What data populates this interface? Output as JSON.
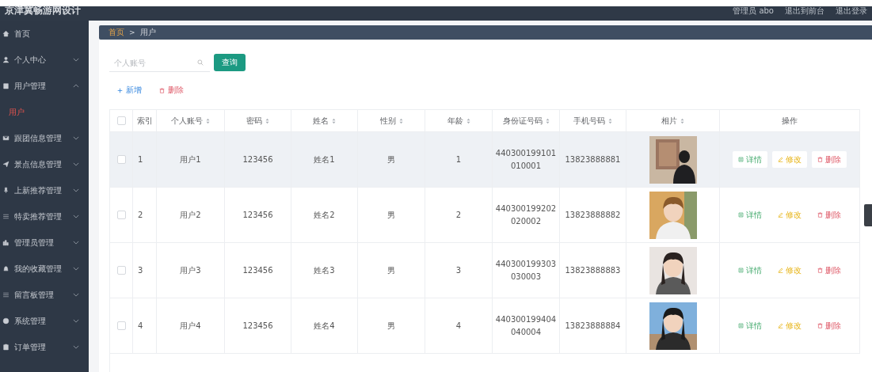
{
  "header": {
    "title": "京津冀畅游网设计",
    "user": "管理员 abo",
    "links": [
      "退出到前台",
      "退出登录"
    ]
  },
  "sidebar": {
    "items": [
      {
        "label": "首页",
        "expandable": false
      },
      {
        "label": "个人中心",
        "expandable": true,
        "expanded": false
      },
      {
        "label": "用户管理",
        "expandable": true,
        "expanded": true,
        "children": [
          {
            "label": "用户",
            "selected": true
          }
        ]
      },
      {
        "label": "跟团信息管理",
        "expandable": true,
        "expanded": false
      },
      {
        "label": "景点信息管理",
        "expandable": true,
        "expanded": false
      },
      {
        "label": "上新推荐管理",
        "expandable": true,
        "expanded": false
      },
      {
        "label": "特卖推荐管理",
        "expandable": true,
        "expanded": false
      },
      {
        "label": "管理员管理",
        "expandable": true,
        "expanded": false
      },
      {
        "label": "我的收藏管理",
        "expandable": true,
        "expanded": false
      },
      {
        "label": "留言板管理",
        "expandable": true,
        "expanded": false
      },
      {
        "label": "系统管理",
        "expandable": true,
        "expanded": false
      },
      {
        "label": "订单管理",
        "expandable": true,
        "expanded": false
      }
    ]
  },
  "breadcrumb": {
    "items": [
      "首页",
      "用户"
    ],
    "separator": ">"
  },
  "search": {
    "placeholder": "个人账号",
    "button": "查询"
  },
  "actions": [
    {
      "kind": "add",
      "label": "新增"
    },
    {
      "kind": "delete",
      "label": "删除"
    }
  ],
  "table": {
    "select_all_checked": false,
    "columns": [
      {
        "kind": "text",
        "label": "索引",
        "sortable": false
      },
      {
        "kind": "text",
        "label": "个人账号",
        "sortable": true
      },
      {
        "kind": "text",
        "label": "密码",
        "sortable": true
      },
      {
        "kind": "text",
        "label": "姓名",
        "sortable": true
      },
      {
        "kind": "text",
        "label": "性别",
        "sortable": true
      },
      {
        "kind": "text",
        "label": "年龄",
        "sortable": true
      },
      {
        "kind": "text",
        "label": "身份证号码",
        "sortable": true
      },
      {
        "kind": "text",
        "label": "手机号码",
        "sortable": true
      },
      {
        "kind": "text",
        "label": "相片",
        "sortable": true
      },
      {
        "kind": "text",
        "label": "操作",
        "sortable": false
      }
    ],
    "rows": [
      {
        "checked": false,
        "highlighted": true,
        "cells": [
          "1",
          "用户1",
          "123456",
          "姓名1",
          "男",
          "1",
          "440300199101010001",
          "13823888881"
        ],
        "photo": {
          "kind": "picture"
        },
        "buttons": [
          {
            "kind": "details",
            "label": "详情"
          },
          {
            "kind": "edit",
            "label": "修改"
          },
          {
            "kind": "delete",
            "label": "删除"
          }
        ]
      },
      {
        "checked": false,
        "highlighted": false,
        "cells": [
          "2",
          "用户2",
          "123456",
          "姓名2",
          "男",
          "2",
          "440300199202020002",
          "13823888882"
        ],
        "photo": {
          "kind": "picture"
        },
        "buttons": [
          {
            "kind": "details",
            "label": "详情"
          },
          {
            "kind": "edit",
            "label": "修改"
          },
          {
            "kind": "delete",
            "label": "删除"
          }
        ]
      },
      {
        "checked": false,
        "highlighted": false,
        "cells": [
          "3",
          "用户3",
          "123456",
          "姓名3",
          "男",
          "3",
          "440300199303030003",
          "13823888883"
        ],
        "photo": {
          "kind": "picture"
        },
        "buttons": [
          {
            "kind": "details",
            "label": "详情"
          },
          {
            "kind": "edit",
            "label": "修改"
          },
          {
            "kind": "delete",
            "label": "删除"
          }
        ]
      },
      {
        "checked": false,
        "highlighted": false,
        "cells": [
          "4",
          "用户4",
          "123456",
          "姓名4",
          "男",
          "4",
          "440300199404040004",
          "13823888884"
        ],
        "photo": {
          "kind": "picture"
        },
        "buttons": [
          {
            "kind": "details",
            "label": "详情"
          },
          {
            "kind": "edit",
            "label": "修改"
          },
          {
            "kind": "delete",
            "label": "删除"
          }
        ]
      }
    ]
  }
}
